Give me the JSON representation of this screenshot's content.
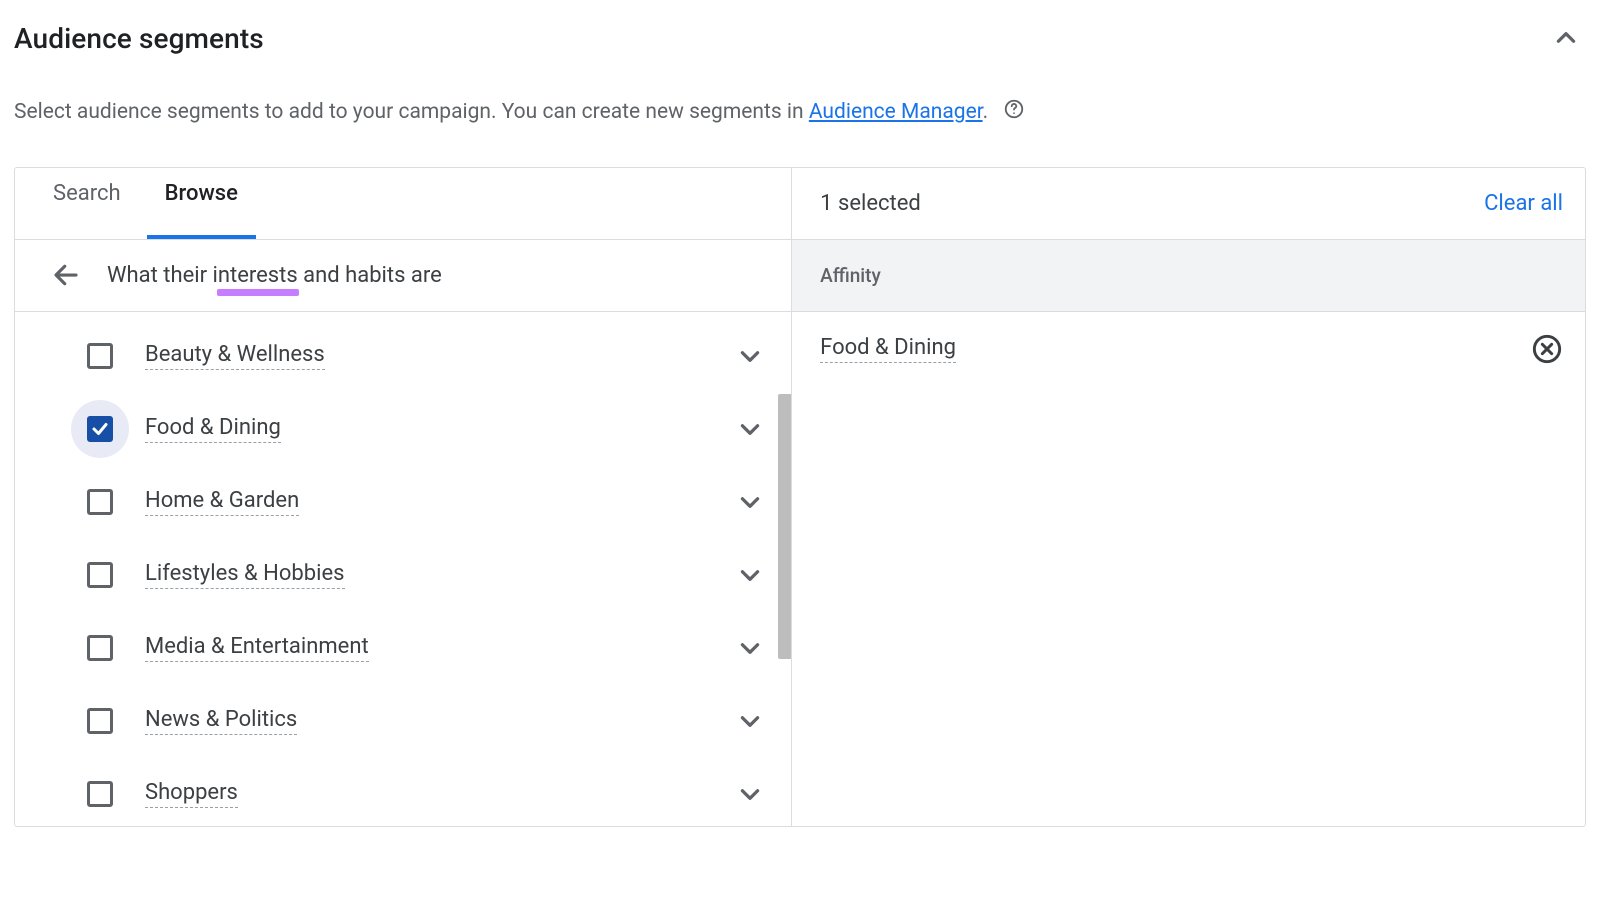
{
  "header": {
    "title": "Audience segments",
    "subtitle_prefix": "Select audience segments to add to your campaign. You can create new segments in ",
    "subtitle_link": "Audience Manager",
    "subtitle_suffix": "."
  },
  "tabs": {
    "search": "Search",
    "browse": "Browse"
  },
  "breadcrumb": {
    "text": "What their interests and habits are"
  },
  "categories": [
    {
      "label": "Beauty & Wellness",
      "checked": false
    },
    {
      "label": "Food & Dining",
      "checked": true
    },
    {
      "label": "Home & Garden",
      "checked": false
    },
    {
      "label": "Lifestyles & Hobbies",
      "checked": false
    },
    {
      "label": "Media & Entertainment",
      "checked": false
    },
    {
      "label": "News & Politics",
      "checked": false
    },
    {
      "label": "Shoppers",
      "checked": false
    }
  ],
  "right": {
    "selected_count": "1 selected",
    "clear_all": "Clear all",
    "group_label": "Affinity",
    "selected_item": "Food & Dining"
  }
}
